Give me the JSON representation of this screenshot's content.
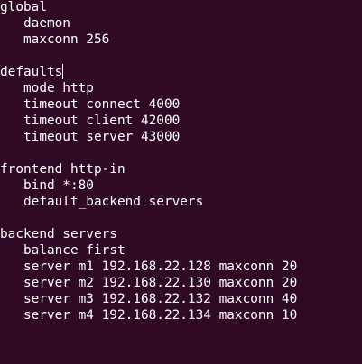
{
  "config_lines": [
    "global",
    "   daemon",
    "   maxconn 256",
    "",
    "defaults",
    "   mode http",
    "   timeout connect 4000",
    "   timeout client 42000",
    "   timeout server 43000",
    "",
    "frontend http-in",
    "   bind *:80",
    "   default_backend servers",
    "",
    "backend servers",
    "   balance first",
    "   server m1 192.168.22.128 maxconn 20",
    "   server m2 192.168.22.130 maxconn 20",
    "   server m3 192.168.22.132 maxconn 40",
    "   server m4 192.168.22.134 maxconn 10"
  ],
  "colors": {
    "background": "#300a24",
    "text": "#ffffff"
  }
}
